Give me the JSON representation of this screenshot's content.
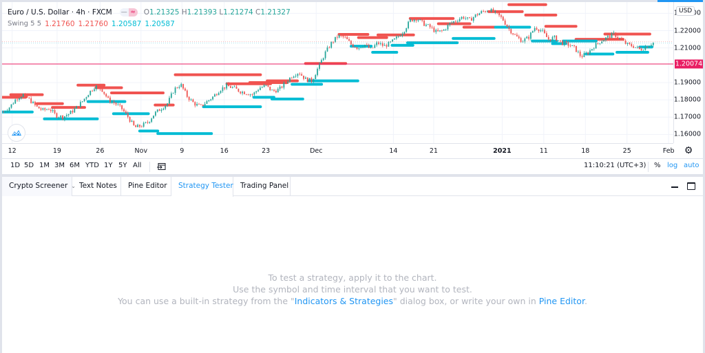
{
  "header": {
    "symbol_title": "Euro / U.S. Dollar · 4h · FXCM",
    "pill_left": "—",
    "pill_right": "≈",
    "ohlc": {
      "o_label": "O",
      "o": "1.21325",
      "h_label": "H",
      "h": "1.21393",
      "l_label": "L",
      "l": "1.21274",
      "c_label": "C",
      "c": "1.21327"
    },
    "indicator": {
      "name": "Swing 5 5",
      "values": [
        "1.21760",
        "1.21760",
        "1.20587",
        "1.20587"
      ]
    }
  },
  "colors": {
    "up": "#26a69a",
    "down": "#ef5350",
    "swing_high": "#f05350",
    "swing_low": "#00bcd4",
    "last_price": "#e91e63",
    "accent": "#2196f3"
  },
  "chart_data": {
    "type": "candlestick",
    "title": "Euro / U.S. Dollar · 4h · FXCM",
    "currency": "USD",
    "ylim": [
      1.155,
      1.2365
    ],
    "y_ticks": [
      "1.23000",
      "1.22000",
      "1.21000",
      "1.19000",
      "1.18000",
      "1.17000",
      "1.16000"
    ],
    "y_tick_values": [
      1.23,
      1.22,
      1.21,
      1.19,
      1.18,
      1.17,
      1.16
    ],
    "x_ticks": [
      {
        "label": "12",
        "pos": 0.015
      },
      {
        "label": "19",
        "pos": 0.082
      },
      {
        "label": "26",
        "pos": 0.146
      },
      {
        "label": "Nov",
        "pos": 0.207
      },
      {
        "label": "9",
        "pos": 0.268
      },
      {
        "label": "16",
        "pos": 0.331
      },
      {
        "label": "23",
        "pos": 0.393
      },
      {
        "label": "Dec",
        "pos": 0.468
      },
      {
        "label": "14",
        "pos": 0.583
      },
      {
        "label": "21",
        "pos": 0.643
      },
      {
        "label": "2021",
        "pos": 0.745,
        "bold": true
      },
      {
        "label": "11",
        "pos": 0.807
      },
      {
        "label": "18",
        "pos": 0.869
      },
      {
        "label": "25",
        "pos": 0.931
      },
      {
        "label": "Feb",
        "pos": 0.993
      }
    ],
    "last_price": "1.20074",
    "last_price_value": 1.20074,
    "current_close": 1.21327,
    "price_path": [
      1.173,
      1.176,
      1.181,
      1.183,
      1.18,
      1.176,
      1.174,
      1.175,
      1.171,
      1.17,
      1.172,
      1.175,
      1.179,
      1.184,
      1.188,
      1.186,
      1.18,
      1.178,
      1.175,
      1.17,
      1.164,
      1.165,
      1.167,
      1.172,
      1.175,
      1.178,
      1.186,
      1.189,
      1.182,
      1.178,
      1.176,
      1.179,
      1.182,
      1.186,
      1.188,
      1.187,
      1.185,
      1.184,
      1.183,
      1.187,
      1.188,
      1.185,
      1.186,
      1.19,
      1.194,
      1.196,
      1.192,
      1.191,
      1.199,
      1.207,
      1.213,
      1.217,
      1.216,
      1.212,
      1.21,
      1.212,
      1.209,
      1.213,
      1.211,
      1.213,
      1.216,
      1.22,
      1.226,
      1.227,
      1.224,
      1.222,
      1.219,
      1.22,
      1.224,
      1.226,
      1.228,
      1.226,
      1.229,
      1.231,
      1.232,
      1.23,
      1.227,
      1.221,
      1.217,
      1.214,
      1.216,
      1.222,
      1.22,
      1.215,
      1.216,
      1.213,
      1.212,
      1.21,
      1.205,
      1.207,
      1.211,
      1.214,
      1.216,
      1.218,
      1.215,
      1.212,
      1.211,
      1.209,
      1.211,
      1.213
    ],
    "swing_highs": [
      {
        "price": 1.1815,
        "from": 0.0,
        "to": 0.035
      },
      {
        "price": 1.183,
        "from": 0.013,
        "to": 0.06
      },
      {
        "price": 1.1778,
        "from": 0.052,
        "to": 0.09
      },
      {
        "price": 1.1756,
        "from": 0.075,
        "to": 0.123
      },
      {
        "price": 1.1885,
        "from": 0.113,
        "to": 0.152
      },
      {
        "price": 1.187,
        "from": 0.14,
        "to": 0.178
      },
      {
        "price": 1.184,
        "from": 0.163,
        "to": 0.24
      },
      {
        "price": 1.177,
        "from": 0.228,
        "to": 0.255
      },
      {
        "price": 1.1945,
        "from": 0.258,
        "to": 0.385
      },
      {
        "price": 1.1893,
        "from": 0.335,
        "to": 0.4
      },
      {
        "price": 1.19,
        "from": 0.369,
        "to": 0.425
      },
      {
        "price": 1.191,
        "from": 0.395,
        "to": 0.44
      },
      {
        "price": 1.201,
        "from": 0.452,
        "to": 0.512
      },
      {
        "price": 1.2178,
        "from": 0.502,
        "to": 0.545
      },
      {
        "price": 1.216,
        "from": 0.531,
        "to": 0.573
      },
      {
        "price": 1.2175,
        "from": 0.56,
        "to": 0.613
      },
      {
        "price": 1.227,
        "from": 0.608,
        "to": 0.672
      },
      {
        "price": 1.224,
        "from": 0.65,
        "to": 0.697
      },
      {
        "price": 1.222,
        "from": 0.688,
        "to": 0.735
      },
      {
        "price": 1.231,
        "from": 0.725,
        "to": 0.775
      },
      {
        "price": 1.235,
        "from": 0.755,
        "to": 0.81
      },
      {
        "price": 1.229,
        "from": 0.78,
        "to": 0.825
      },
      {
        "price": 1.2225,
        "from": 0.81,
        "to": 0.855
      },
      {
        "price": 1.215,
        "from": 0.855,
        "to": 0.925
      },
      {
        "price": 1.218,
        "from": 0.898,
        "to": 0.965
      }
    ],
    "swing_lows": [
      {
        "price": 1.173,
        "from": 0.0,
        "to": 0.045
      },
      {
        "price": 1.169,
        "from": 0.063,
        "to": 0.142
      },
      {
        "price": 1.179,
        "from": 0.128,
        "to": 0.183
      },
      {
        "price": 1.172,
        "from": 0.166,
        "to": 0.218
      },
      {
        "price": 1.162,
        "from": 0.205,
        "to": 0.232
      },
      {
        "price": 1.1605,
        "from": 0.232,
        "to": 0.312
      },
      {
        "price": 1.176,
        "from": 0.3,
        "to": 0.385
      },
      {
        "price": 1.1815,
        "from": 0.375,
        "to": 0.405
      },
      {
        "price": 1.1805,
        "from": 0.402,
        "to": 0.448
      },
      {
        "price": 1.189,
        "from": 0.432,
        "to": 0.476
      },
      {
        "price": 1.191,
        "from": 0.456,
        "to": 0.53
      },
      {
        "price": 1.211,
        "from": 0.52,
        "to": 0.55
      },
      {
        "price": 1.2075,
        "from": 0.552,
        "to": 0.588
      },
      {
        "price": 1.2115,
        "from": 0.581,
        "to": 0.612
      },
      {
        "price": 1.213,
        "from": 0.604,
        "to": 0.678
      },
      {
        "price": 1.2155,
        "from": 0.672,
        "to": 0.733
      },
      {
        "price": 1.222,
        "from": 0.735,
        "to": 0.786
      },
      {
        "price": 1.214,
        "from": 0.79,
        "to": 0.826
      },
      {
        "price": 1.2125,
        "from": 0.82,
        "to": 0.84
      },
      {
        "price": 1.214,
        "from": 0.836,
        "to": 0.885
      },
      {
        "price": 1.2065,
        "from": 0.87,
        "to": 0.91
      },
      {
        "price": 1.2075,
        "from": 0.916,
        "to": 0.962
      },
      {
        "price": 1.2105,
        "from": 0.95,
        "to": 0.968
      }
    ]
  },
  "toolbar": {
    "ranges": [
      "1D",
      "5D",
      "1M",
      "3M",
      "6M",
      "YTD",
      "1Y",
      "5Y",
      "All"
    ],
    "clock": "11:10:21 (UTC+3)",
    "percent": "%",
    "log": "log",
    "auto": "auto"
  },
  "panel": {
    "tabs": [
      {
        "label": "Crypto Screener"
      },
      {
        "label": "Text Notes"
      },
      {
        "label": "Pine Editor"
      },
      {
        "label": "Strategy Tester",
        "active": true
      },
      {
        "label": "Trading Panel"
      }
    ],
    "message": {
      "line1": "To test a strategy, apply it to the chart.",
      "line2": "Use the symbol and time interval that you want to test.",
      "line3_pre": "You can use a built-in strategy from the \"",
      "line3_link1": "Indicators & Strategies",
      "line3_mid": "\" dialog box, or write your own in ",
      "line3_link2": "Pine Editor",
      "line3_post": "."
    }
  }
}
